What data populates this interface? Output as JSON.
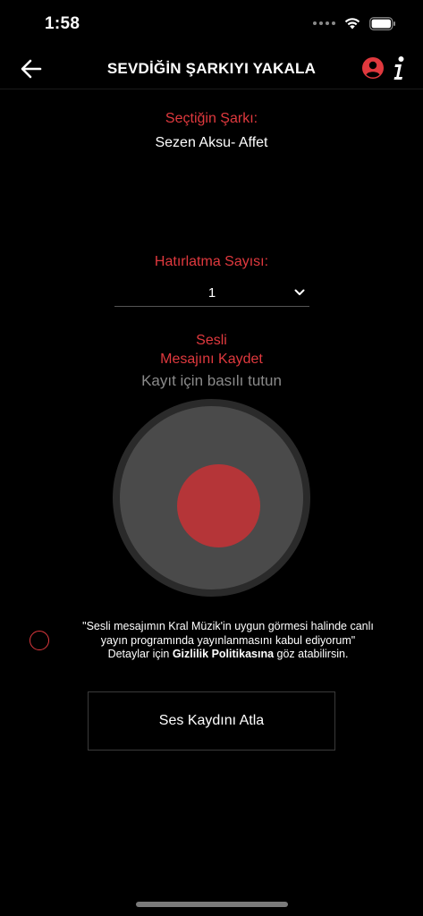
{
  "status": {
    "time": "1:58"
  },
  "nav": {
    "title": "SEVDİĞİN ŞARKIYI YAKALA",
    "back_icon": "arrow-left-icon",
    "profile_icon": "user-circle-icon",
    "info_icon": "info-icon"
  },
  "song": {
    "label": "Seçtiğin Şarkı:",
    "name": "Sezen Aksu- Affet"
  },
  "reminder": {
    "label": "Hatırlatma Sayısı:",
    "selected": "1"
  },
  "voice": {
    "title_line1": "Sesli",
    "title_line2": "Mesajını Kaydet",
    "hint": "Kayıt için basılı tutun"
  },
  "consent": {
    "line1": "\"Sesli mesajımın Kral Müzik'in uygun görmesi halinde canlı",
    "line2": "yayın programında yayınlanmasını kabul ediyorum\"",
    "line3_prefix": "Detaylar için ",
    "privacy_link": "Gizlilik Politikasına",
    "line3_suffix": " göz atabilirsin."
  },
  "skip_button": "Ses Kaydını Atla",
  "colors": {
    "accent": "#e0393e",
    "background": "#000000",
    "record_dot": "#b53538"
  }
}
